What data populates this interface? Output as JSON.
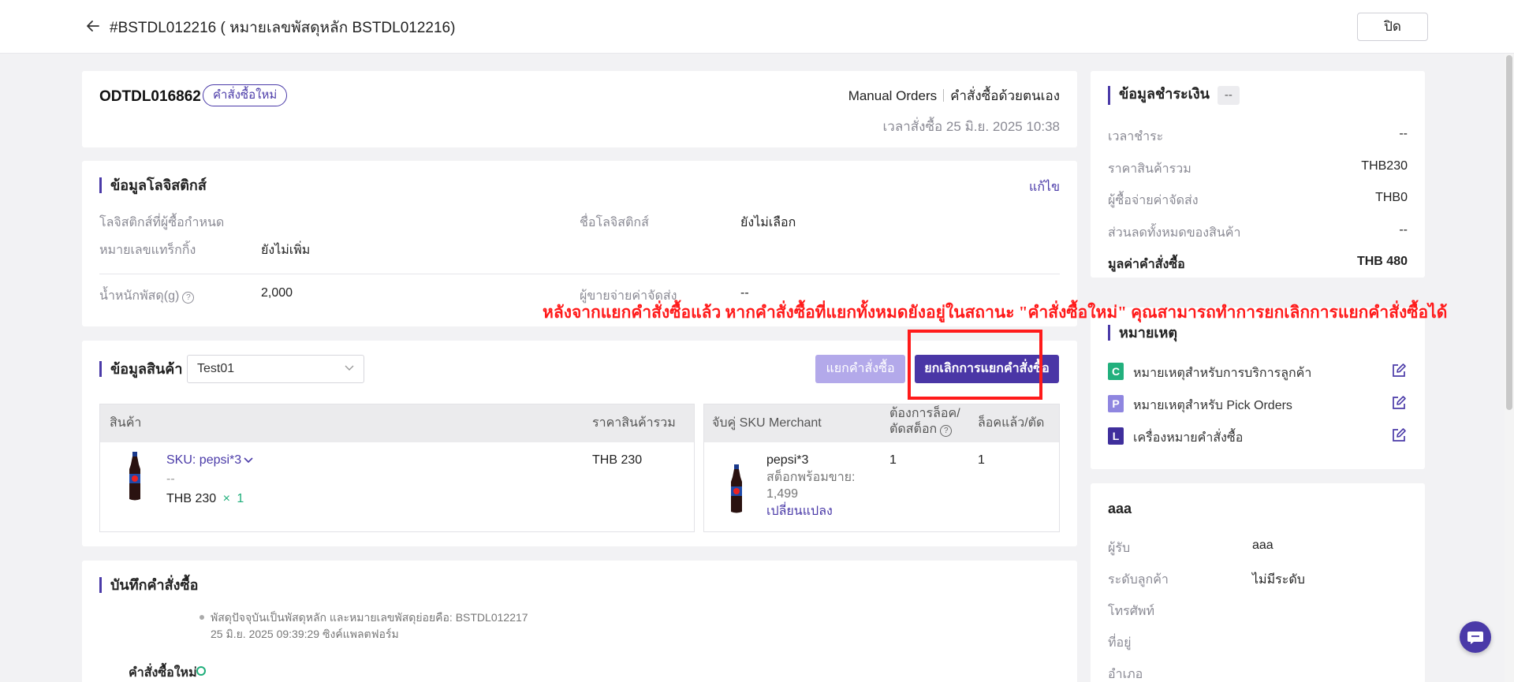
{
  "header": {
    "title": "#BSTDL012216 ( หมายเลขพัสดุหลัก BSTDL012216)",
    "close_label": "ปิด"
  },
  "order": {
    "order_no": "ODTDL016862",
    "status_badge": "คำสั่งซื้อใหม่",
    "source": "Manual Orders",
    "source_type": "คำสั่งซื้อด้วยตนเอง",
    "order_time": "เวลาสั่งซื้อ 25 มิ.ย. 2025 10:38"
  },
  "logistics": {
    "title": "ข้อมูลโลจิสติกส์",
    "edit_label": "แก้ไข",
    "buyer_logistics_label": "โลจิสติกส์ที่ผู้ซื้อกำหนด",
    "logistics_name_label": "ชื่อโลจิสติกส์",
    "logistics_name_value": "ยังไม่เลือก",
    "tracking_label": "หมายเลขแทร็กกิ้ง",
    "tracking_value": "ยังไม่เพิ่ม",
    "weight_label": "น้ำหนักพัสดุ(g)",
    "weight_value": "2,000",
    "shipping_payer_label": "ผู้ขายจ่ายค่าจัดส่ง",
    "shipping_payer_value": "--"
  },
  "products": {
    "title": "ข้อมูลสินค้า",
    "store_select": "Test01",
    "split_button": "แยกคำสั่งซื้อ",
    "cancel_split_button": "ยกเลิกการแยกคำสั่งซื้อ",
    "columns": {
      "product": "สินค้า",
      "total_price": "ราคาสินค้ารวม",
      "sku_merchant": "จับคู่ SKU Merchant",
      "need_lock_1": "ต้องการล็อค/",
      "need_lock_2": "ตัดสต็อก",
      "locked": "ล็อคแล้ว/ตัด"
    },
    "row": {
      "sku": "SKU: pepsi*3",
      "dash": "--",
      "price": "THB 230",
      "times": "×",
      "qty": "1",
      "total": "THB 230",
      "merchant_name": "pepsi*3",
      "stock_label": "สต็อกพร้อมขาย:",
      "stock_value": "1,499",
      "change_link": "เปลี่ยนแปลง",
      "need_lock_value": "1",
      "locked_value": "1"
    }
  },
  "log": {
    "title": "บันทึกคำสั่งซื้อ",
    "entry_text": "พัสดุปัจจุบันเป็นพัสดุหลัก และหมายเลขพัสดุย่อยคือ: BSTDL012217",
    "entry_time": "25 มิ.ย. 2025 09:39:29 ซิงค์แพลตฟอร์ม",
    "status": "คำสั่งซื้อใหม่"
  },
  "payment": {
    "title": "ข้อมูลชำระเงิน",
    "badge": "--",
    "rows": [
      {
        "label": "เวลาชำระ",
        "value": "--"
      },
      {
        "label": "ราคาสินค้ารวม",
        "value": "THB230"
      },
      {
        "label": "ผู้ซื้อจ่ายค่าจัดส่ง",
        "value": "THB0"
      },
      {
        "label": "ส่วนลดทั้งหมดของสินค้า",
        "value": "--"
      }
    ],
    "total_label": "มูลค่าคำสั่งซื้อ",
    "total_value": "THB 480"
  },
  "notes": {
    "title": "หมายเหตุ",
    "items": [
      {
        "letter": "C",
        "label": "หมายเหตุสำหรับการบริการลูกค้า",
        "color": "#22b07d"
      },
      {
        "letter": "P",
        "label": "หมายเหตุสำหรับ Pick Orders",
        "color": "#8f86e0"
      },
      {
        "letter": "L",
        "label": "เครื่องหมายคำสั่งซื้อ",
        "color": "#3f2f9c"
      }
    ]
  },
  "customer": {
    "name": "aaa",
    "receiver_label": "ผู้รับ",
    "receiver_value": "aaa",
    "level_label": "ระดับลูกค้า",
    "level_value": "ไม่มีระดับ",
    "phone_label": "โทรศัพท์",
    "address_label": "ที่อยู่",
    "district_label": "อำเภอ"
  },
  "annotation": {
    "text": "หลังจากแยกคำสั่งซื้อแล้ว หากคำสั่งซื้อที่แยกทั้งหมดยังอยู่ในสถานะ \"คำสั่งซื้อใหม่\" คุณสามารถทำการยกเลิกการแยกคำสั่งซื้อได้",
    "color": "#ff1a1a"
  },
  "theme": {
    "accent": "#4a3aa8"
  }
}
